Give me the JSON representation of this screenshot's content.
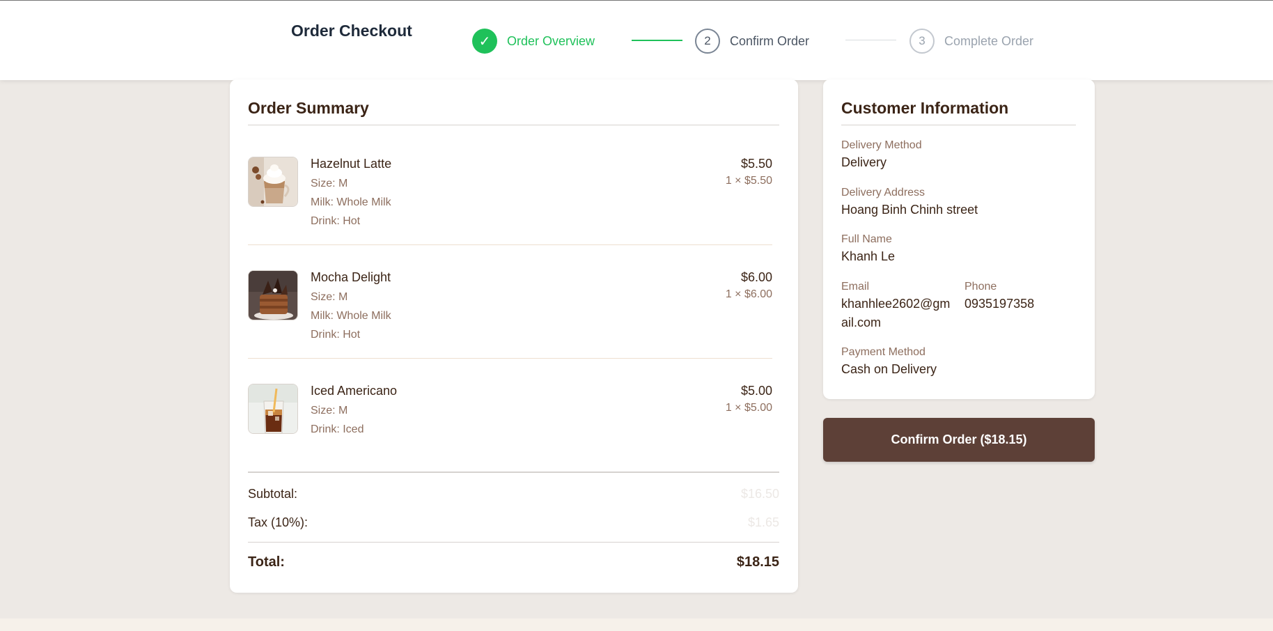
{
  "header": {
    "title": "Order Checkout",
    "steps": [
      {
        "marker": "✓",
        "label": "Order Overview",
        "state": "completed",
        "icon": "check-icon"
      },
      {
        "marker": "2",
        "label": "Confirm Order",
        "state": "current"
      },
      {
        "marker": "3",
        "label": "Complete Order",
        "state": "upcoming"
      }
    ]
  },
  "summary": {
    "title": "Order Summary",
    "items": [
      {
        "name": "Hazelnut Latte",
        "options": [
          "Size: M",
          "Milk: Whole Milk",
          "Drink: Hot"
        ],
        "price": "$5.50",
        "qty": "1 × $5.50",
        "image": "hazelnut-latte-image"
      },
      {
        "name": "Mocha Delight",
        "options": [
          "Size: M",
          "Milk: Whole Milk",
          "Drink: Hot"
        ],
        "price": "$6.00",
        "qty": "1 × $6.00",
        "image": "mocha-delight-image"
      },
      {
        "name": "Iced Americano",
        "options": [
          "Size: M",
          "Drink: Iced"
        ],
        "price": "$5.00",
        "qty": "1 × $5.00",
        "image": "iced-americano-image"
      }
    ],
    "subtotal_label": "Subtotal:",
    "subtotal_value": "$16.50",
    "tax_label": "Tax (10%):",
    "tax_value": "$1.65",
    "total_label": "Total:",
    "total_value": "$18.15"
  },
  "customer": {
    "title": "Customer Information",
    "delivery_method_label": "Delivery Method",
    "delivery_method": "Delivery",
    "delivery_address_label": "Delivery Address",
    "delivery_address": "Hoang Binh Chinh street",
    "full_name_label": "Full Name",
    "full_name": "Khanh Le",
    "email_label": "Email",
    "email_line1": "khanhlee2602@gm",
    "email_line2": "ail.com",
    "phone_label": "Phone",
    "phone": "0935197358",
    "payment_method_label": "Payment Method",
    "payment_method": "Cash on Delivery"
  },
  "actions": {
    "confirm_label": "Confirm Order ($18.15)"
  },
  "colors": {
    "accent_green": "#1fc15a",
    "brand_brown": "#5d4037",
    "text_brown": "#3b2416",
    "muted_brown": "#8d6e5e",
    "page_bg": "#ede9e5"
  }
}
